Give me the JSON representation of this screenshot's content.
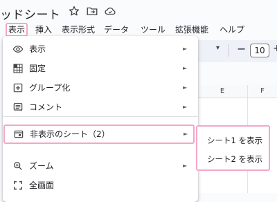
{
  "app": {
    "title": "ッドシート",
    "title_icons": [
      "star-icon",
      "move-to-folder-icon",
      "cloud-saved-icon"
    ]
  },
  "menubar": {
    "items": [
      {
        "label": "表示",
        "active": true
      },
      {
        "label": "挿入"
      },
      {
        "label": "表示形式"
      },
      {
        "label": "データ"
      },
      {
        "label": "ツール"
      },
      {
        "label": "拡張機能"
      },
      {
        "label": "ヘルプ"
      }
    ]
  },
  "toolbar": {
    "font_size": "10",
    "minus": "−",
    "plus": "+",
    "caret": "▾"
  },
  "grid": {
    "columns": [
      "E",
      "F"
    ]
  },
  "view_menu": {
    "items": [
      {
        "label": "表示",
        "icon": "eye-icon",
        "has_submenu": true
      },
      {
        "label": "固定",
        "icon": "freeze-grid-icon",
        "has_submenu": true
      },
      {
        "label": "グループ化",
        "icon": "add-box-icon",
        "has_submenu": true
      },
      {
        "label": "コメント",
        "icon": "comment-icon",
        "has_submenu": true
      },
      {
        "label": "非表示のシート（2）",
        "icon": "hidden-sheet-icon",
        "has_submenu": true,
        "highlighted": true
      },
      {
        "label": "ズーム",
        "icon": "zoom-icon",
        "has_submenu": true
      },
      {
        "label": "全画面",
        "icon": "fullscreen-icon",
        "has_submenu": false
      }
    ],
    "submenu_arrow": "►"
  },
  "hidden_sheets_submenu": {
    "items": [
      {
        "label": "シート1 を表示"
      },
      {
        "label": "シート2 を表示"
      }
    ]
  },
  "colors": {
    "highlight_border": "#f4a6c8",
    "page_bg": "#f9fbfd",
    "toolbar_bg": "#eef2f8"
  }
}
